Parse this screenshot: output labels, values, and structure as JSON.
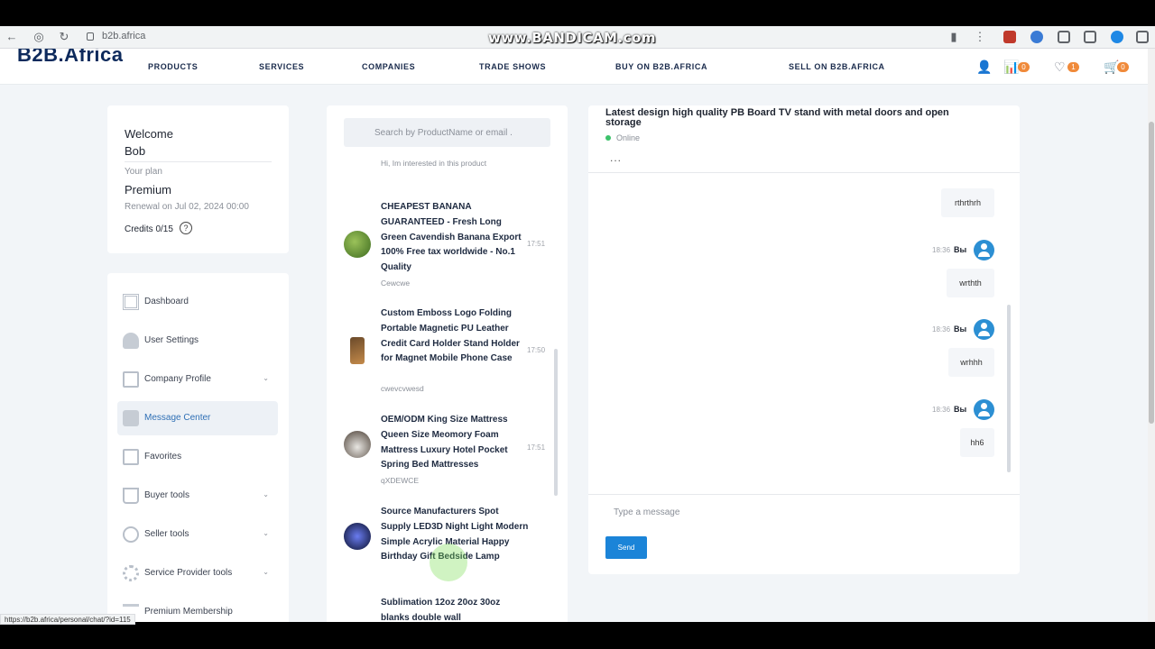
{
  "browser": {
    "url": "b2b.africa",
    "watermark": "www.BANDICAM.com",
    "status_url": "https://b2b.africa/personal/chat/?id=115"
  },
  "header": {
    "logo_main": "B2B",
    "logo_suffix": ".Africa",
    "menu": [
      "PRODUCTS",
      "SERVICES",
      "COMPANIES",
      "TRADE SHOWS",
      "BUY ON B2B.AFRICA",
      "SELL ON B2B.AFRICA"
    ],
    "compare_count": "0",
    "favorites_count": "1",
    "cart_count": "0"
  },
  "account": {
    "welcome_line1": "Welcome",
    "welcome_line2": "Bob",
    "plan_label": "Your plan",
    "plan_name": "Premium",
    "renewal": "Renewal on Jul 02, 2024 00:00",
    "credits": "Credits 0/15",
    "help": "?"
  },
  "sidebar": {
    "items": [
      {
        "label": "Dashboard"
      },
      {
        "label": "User Settings"
      },
      {
        "label": "Company Profile"
      },
      {
        "label": "Message Center"
      },
      {
        "label": "Favorites"
      },
      {
        "label": "Buyer tools"
      },
      {
        "label": "Seller tools"
      },
      {
        "label": "Service Provider tools"
      },
      {
        "label": "Premium Membership"
      }
    ]
  },
  "chat_list": {
    "search_placeholder": "Search by ProductName or email .",
    "partial_top": "Hi, Im interested in this product",
    "items": [
      {
        "title": "CHEAPEST BANANA GUARANTEED - Fresh Long Green Cavendish Banana Export 100% Free tax worldwide - No.1 Quality",
        "sub": "Cewcwe",
        "time": "17:51"
      },
      {
        "title": "Custom Emboss Logo Folding Portable Magnetic PU Leather Credit Card Holder Stand Holder for Magnet Mobile Phone Case",
        "sub": "cwevcvwesd",
        "time": "17:50"
      },
      {
        "title": "OEM/ODM King Size Mattress Queen Size Meomory Foam Mattress Luxury Hotel Pocket Spring Bed Mattresses",
        "sub": "qXDEWCE",
        "time": "17:51"
      },
      {
        "title": "Source Manufacturers Spot Supply LED3D Night Light Modern Simple Acrylic Material Happy Birthday Gift Bedside Lamp",
        "sub": "",
        "time": ""
      },
      {
        "title": "Sublimation 12oz 20oz 30oz blanks double wall",
        "sub": "",
        "time": ""
      }
    ]
  },
  "chat": {
    "title": "Latest design high quality PB Board TV stand with metal doors and open storage",
    "status": "Online",
    "more": "...",
    "messages": [
      {
        "time": "",
        "name": "",
        "text": "rthrthrh"
      },
      {
        "time": "18:36",
        "name": "Вы",
        "text": "wrthth"
      },
      {
        "time": "18:36",
        "name": "Вы",
        "text": "wrhhh"
      },
      {
        "time": "18:36",
        "name": "Вы",
        "text": "hh6"
      }
    ],
    "input_placeholder": "Type a message",
    "send_label": "Send"
  }
}
